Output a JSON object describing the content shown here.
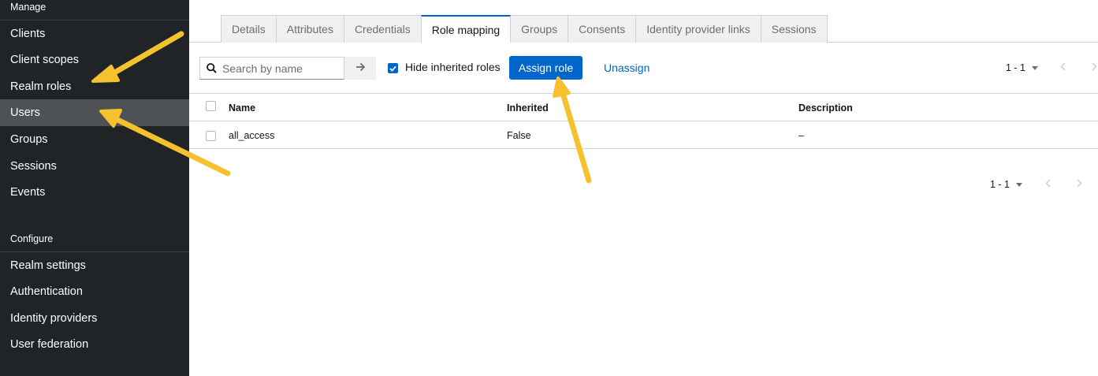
{
  "sidebar": {
    "manage_title": "Manage",
    "manage_items": [
      {
        "label": "Clients"
      },
      {
        "label": "Client scopes"
      },
      {
        "label": "Realm roles"
      },
      {
        "label": "Users"
      },
      {
        "label": "Groups"
      },
      {
        "label": "Sessions"
      },
      {
        "label": "Events"
      }
    ],
    "configure_title": "Configure",
    "configure_items": [
      {
        "label": "Realm settings"
      },
      {
        "label": "Authentication"
      },
      {
        "label": "Identity providers"
      },
      {
        "label": "User federation"
      }
    ]
  },
  "tabs": [
    {
      "label": "Details"
    },
    {
      "label": "Attributes"
    },
    {
      "label": "Credentials"
    },
    {
      "label": "Role mapping",
      "active": true
    },
    {
      "label": "Groups"
    },
    {
      "label": "Consents"
    },
    {
      "label": "Identity provider links"
    },
    {
      "label": "Sessions"
    }
  ],
  "toolbar": {
    "search_placeholder": "Search by name",
    "hide_inherited_label": "Hide inherited roles",
    "hide_inherited_checked": true,
    "assign_label": "Assign role",
    "unassign_label": "Unassign",
    "pagination_top": "1 - 1"
  },
  "table": {
    "columns": [
      "Name",
      "Inherited",
      "Description"
    ],
    "rows": [
      {
        "name": "all_access",
        "inherited": "False",
        "description": "–"
      }
    ]
  },
  "pagination_bottom": "1 - 1",
  "colors": {
    "sidebar_bg": "#212427",
    "sidebar_active_bg": "#4f5255",
    "primary": "#0066cc",
    "annotation_arrow": "#f5c12e"
  }
}
